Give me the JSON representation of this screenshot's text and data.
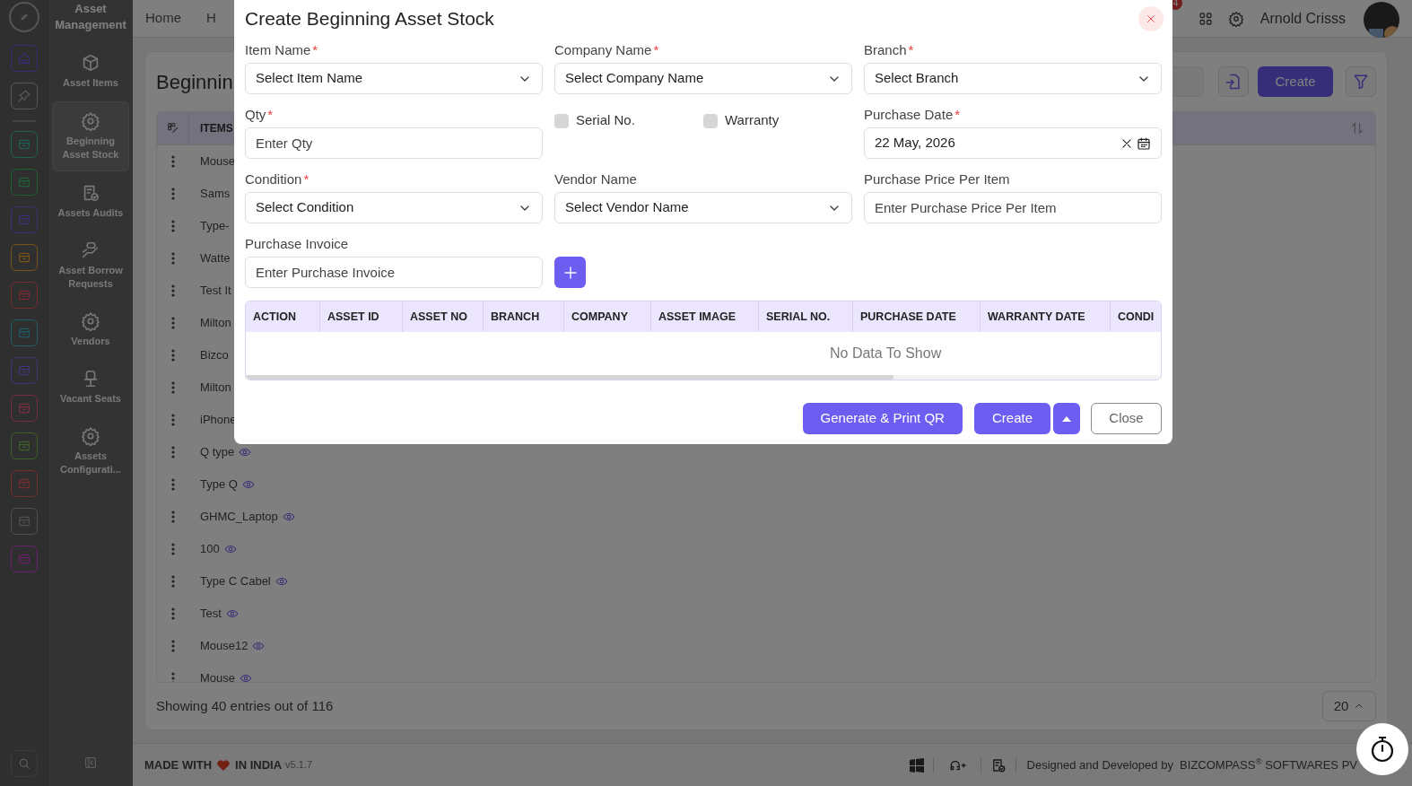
{
  "app_title": "Asset Management",
  "menu": [
    {
      "label": "Asset Items",
      "selected": false
    },
    {
      "label": "Beginning Asset Stock",
      "selected": true
    },
    {
      "label": "Assets Audits",
      "selected": false
    },
    {
      "label": "Asset Borrow Requests",
      "selected": false
    },
    {
      "label": "Vendors",
      "selected": false
    },
    {
      "label": "Vacant Seats",
      "selected": false
    },
    {
      "label": "Assets Configurati...",
      "selected": false
    }
  ],
  "topbar": {
    "nav": [
      "Home",
      "H"
    ],
    "notification_count": "4",
    "user": "Arnold Crisss"
  },
  "page": {
    "title": "Beginnin",
    "create_button": "Create",
    "column": "ITEMS",
    "rows": [
      {
        "name": "Mouse"
      },
      {
        "name": "Sams"
      },
      {
        "name": "Type-"
      },
      {
        "name": "Watte"
      },
      {
        "name": "Test It"
      },
      {
        "name": "Milton"
      },
      {
        "name": "Bizco"
      },
      {
        "name": "Milton"
      },
      {
        "name": "iPhone"
      },
      {
        "name": "Q type",
        "eye": true
      },
      {
        "name": "Type Q",
        "eye": true
      },
      {
        "name": "GHMC_Laptop",
        "eye": true
      },
      {
        "name": "100",
        "eye": true
      },
      {
        "name": "Type C Cabel",
        "eye": true
      },
      {
        "name": "Test",
        "eye": true
      },
      {
        "name": "Mouse12",
        "eye": true
      },
      {
        "name": "Mouse",
        "eye": true
      }
    ],
    "entries": "Showing 40 entries out of 116",
    "page_size": "20"
  },
  "footer": {
    "left": "MADE WITH",
    "left_after": "IN INDIA",
    "version": "v5.1.7",
    "credit": "Designed and Developed by  BIZCOMPASS$^{®}$ SOFTWARES PV"
  },
  "modal": {
    "title": "Create Beginning Asset Stock",
    "fields": [
      {
        "kind": "select",
        "label": "Item Name",
        "mark": "*",
        "placeholder": "Select Item Name"
      },
      {
        "kind": "select",
        "label": "Company Name",
        "mark": "*",
        "placeholder": "Select Company Name"
      },
      {
        "kind": "select",
        "label": "Branch",
        "mark": "*",
        "placeholder": "Select Branch"
      },
      {
        "kind": "input",
        "label": "Qty",
        "mark": "*",
        "placeholder": "Enter Qty"
      },
      {
        "kind": "checkboxes",
        "options": [
          {
            "label": "Serial No.",
            "checked": false
          },
          {
            "label": "Warranty",
            "checked": false
          }
        ]
      },
      {
        "kind": "date",
        "label": "Purchase Date",
        "mark": "*",
        "value": "22 May, 2026"
      },
      {
        "kind": "select",
        "label": "Condition",
        "mark": "*",
        "placeholder": "Select Condition"
      },
      {
        "kind": "select",
        "label": "Vendor Name",
        "placeholder": "Select Vendor Name"
      },
      {
        "kind": "input",
        "label": "Purchase Price Per Item",
        "placeholder": "Enter Purchase Price Per Item"
      },
      {
        "kind": "input_add",
        "label": "Purchase Invoice",
        "placeholder": "Enter Purchase Invoice"
      }
    ],
    "table": {
      "columns": [
        "ACTION",
        "ASSET ID",
        "ASSET NO",
        "BRANCH",
        "COMPANY",
        "ASSET IMAGE",
        "SERIAL NO.",
        "PURCHASE DATE",
        "WARRANTY DATE",
        "CONDI"
      ],
      "empty": "No Data To Show"
    },
    "buttons": [
      {
        "kind": "primary",
        "label": "Generate & Print QR"
      },
      {
        "kind": "primary",
        "label": "Create"
      },
      {
        "kind": "caret"
      },
      {
        "kind": "outline",
        "label": "Close"
      }
    ]
  }
}
